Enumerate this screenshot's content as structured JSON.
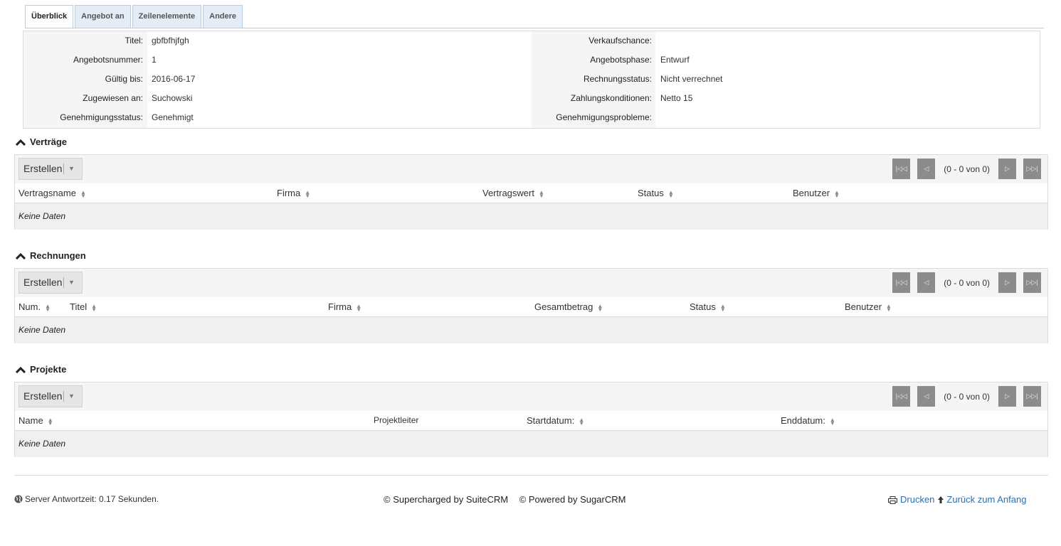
{
  "tabs": [
    {
      "label": "Überblick",
      "active": true
    },
    {
      "label": "Angebot an",
      "active": false
    },
    {
      "label": "Zeilenelemente",
      "active": false
    },
    {
      "label": "Andere",
      "active": false
    }
  ],
  "detail": {
    "left": [
      {
        "label": "Titel:",
        "value": "gbfbfhjfgh"
      },
      {
        "label": "Angebotsnummer:",
        "value": "1"
      },
      {
        "label": "Gültig bis:",
        "value": "2016-06-17"
      },
      {
        "label": "Zugewiesen an:",
        "value": "Suchowski"
      },
      {
        "label": "Genehmigungsstatus:",
        "value": "Genehmigt"
      }
    ],
    "right": [
      {
        "label": "Verkaufschance:",
        "value": ""
      },
      {
        "label": "Angebotsphase:",
        "value": "Entwurf"
      },
      {
        "label": "Rechnungsstatus:",
        "value": "Nicht verrechnet"
      },
      {
        "label": "Zahlungskonditionen:",
        "value": "Netto 15"
      },
      {
        "label": "Genehmigungsprobleme:",
        "value": ""
      }
    ]
  },
  "subpanels": [
    {
      "title": "Verträge",
      "create_label": "Erstellen",
      "pager_text": "(0 - 0 von 0)",
      "columns": [
        "Vertragsname",
        "Firma",
        "Vertragswert",
        "Status",
        "Benutzer"
      ],
      "empty_text": "Keine Daten"
    },
    {
      "title": "Rechnungen",
      "create_label": "Erstellen",
      "pager_text": "(0 - 0 von 0)",
      "columns": [
        "Num.",
        "Titel",
        "Firma",
        "Gesamtbetrag",
        "Status",
        "Benutzer"
      ],
      "empty_text": "Keine Daten"
    },
    {
      "title": "Projekte",
      "create_label": "Erstellen",
      "pager_text": "(0 - 0 von 0)",
      "columns": [
        "Name",
        "Projektleiter",
        "Startdatum:",
        "Enddatum:"
      ],
      "empty_text": "Keine Daten"
    }
  ],
  "footer": {
    "server_time": "Server Antwortzeit: 0.17 Sekunden.",
    "supercharged": "© Supercharged by SuiteCRM",
    "powered": "© Powered by SugarCRM",
    "print_label": "Drucken",
    "top_label": "Zurück zum Anfang"
  },
  "colors": {
    "tab_bg": "#e4edf5",
    "label_bg": "#f5f5f5",
    "pager_btn": "#8c8c8c",
    "link": "#2a6fb0"
  }
}
